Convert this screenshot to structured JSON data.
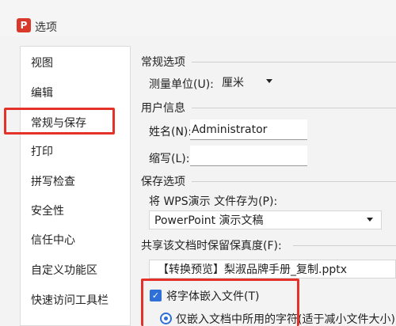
{
  "window": {
    "title": "选项",
    "app_icon_letter": "P"
  },
  "sidebar": {
    "items": [
      {
        "label": "视图"
      },
      {
        "label": "编辑"
      },
      {
        "label": "常规与保存"
      },
      {
        "label": "打印"
      },
      {
        "label": "拼写检查"
      },
      {
        "label": "安全性"
      },
      {
        "label": "信任中心"
      },
      {
        "label": "自定义功能区"
      },
      {
        "label": "快速访问工具栏"
      }
    ],
    "selected_index": 2
  },
  "general": {
    "section_title": "常规选项",
    "unit_label": "测量单位(U):",
    "unit_value": "厘米"
  },
  "user_info": {
    "section_title": "用户信息",
    "name_label": "姓名(N):",
    "name_value": "Administrator",
    "initials_label": "缩写(L):",
    "initials_value": ""
  },
  "save": {
    "section_title": "保存选项",
    "save_as_label": "将 WPS演示 文件存为(P):",
    "save_as_value": "PowerPoint 演示文稿"
  },
  "sharing": {
    "section_title": "共享该文档时保留保真度(F):",
    "file_value": "【转换预览】梨淑品牌手册_复制.pptx",
    "embed_fonts_label": "将字体嵌入文件(T)",
    "embed_fonts_checked": true,
    "embed_used_chars_label": "仅嵌入文档中所用的字符(适于减小文件大小)(I)"
  },
  "colors": {
    "accent": "#2f6fd8",
    "highlight": "#e4322b",
    "brand": "#d9392b"
  }
}
